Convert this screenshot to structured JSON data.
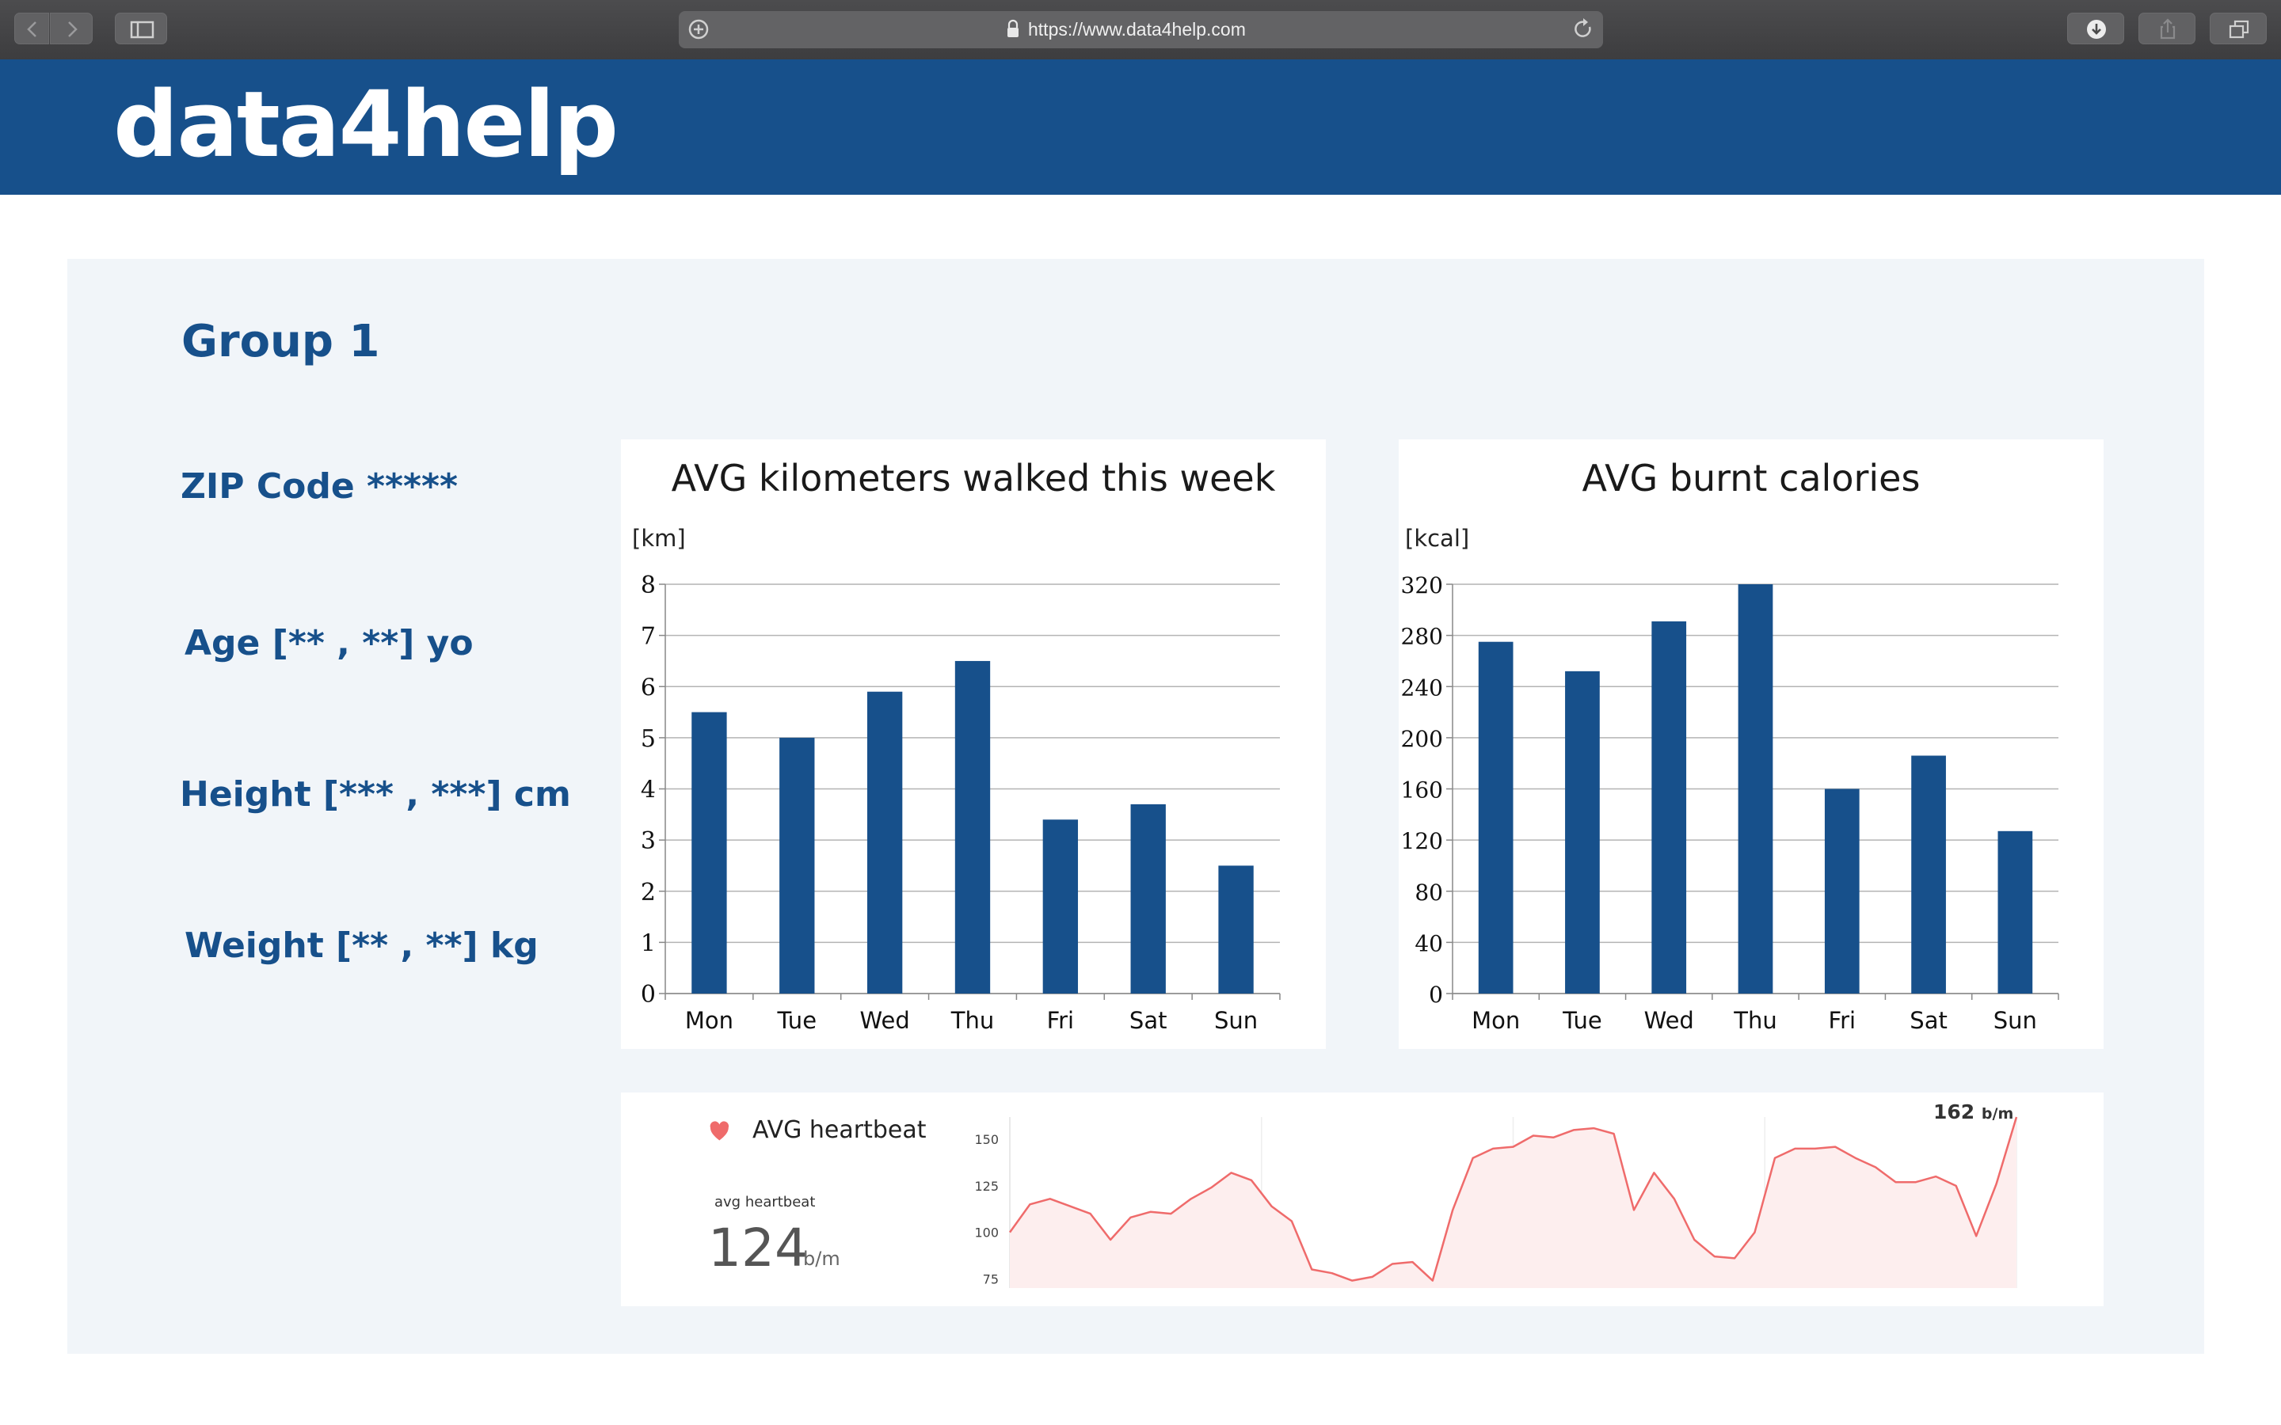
{
  "browser": {
    "url": "https://www.data4help.com"
  },
  "header": {
    "logo": "data4help"
  },
  "group": {
    "title": "Group 1",
    "info": [
      "ZIP Code *****",
      "Age [** , **] yo",
      "Height [*** , ***] cm",
      "Weight [** , **] kg"
    ]
  },
  "colors": {
    "brand": "#17508b",
    "panel_bg": "#f1f5f9",
    "heartbeat_line": "#ef6b6b",
    "heartbeat_fill": "#fdeeee"
  },
  "chart_data": [
    {
      "type": "bar",
      "title": "AVG kilometers walked this week",
      "ylabel": "[km]",
      "categories": [
        "Mon",
        "Tue",
        "Wed",
        "Thu",
        "Fri",
        "Sat",
        "Sun"
      ],
      "values": [
        5.5,
        5.0,
        5.9,
        6.5,
        3.4,
        3.7,
        2.5
      ],
      "ylim": [
        0,
        8
      ],
      "yticks": [
        0,
        1,
        2,
        3,
        4,
        5,
        6,
        7,
        8
      ],
      "grid": true,
      "color": "#17508b"
    },
    {
      "type": "bar",
      "title": "AVG burnt calories",
      "ylabel": "[kcal]",
      "categories": [
        "Mon",
        "Tue",
        "Wed",
        "Thu",
        "Fri",
        "Sat",
        "Sun"
      ],
      "values": [
        275,
        252,
        291,
        320,
        160,
        186,
        127
      ],
      "ylim": [
        0,
        320
      ],
      "yticks": [
        0,
        40,
        80,
        120,
        160,
        200,
        240,
        280,
        320
      ],
      "grid": true,
      "color": "#17508b"
    },
    {
      "type": "area",
      "title": "AVG heartbeat",
      "summary_label": "avg heartbeat",
      "summary_value": "124",
      "summary_unit": "b/m",
      "peak_value": "162",
      "peak_unit": "b/m",
      "ylim": [
        70,
        162
      ],
      "yticks": [
        75,
        100,
        125,
        150
      ],
      "x": [
        0,
        2,
        4,
        6,
        8,
        10,
        12,
        14,
        16,
        18,
        20,
        22,
        24,
        26,
        28,
        30,
        32,
        34,
        36,
        38,
        40,
        42,
        44,
        46,
        48,
        50,
        52,
        54,
        56,
        58,
        60,
        62,
        64,
        66,
        68,
        70,
        72,
        74,
        76,
        78,
        80,
        82,
        84,
        86,
        88,
        90,
        92,
        94,
        96,
        98,
        100
      ],
      "y": [
        100,
        115,
        118,
        114,
        110,
        96,
        108,
        111,
        110,
        118,
        124,
        132,
        128,
        114,
        106,
        80,
        78,
        74,
        76,
        83,
        84,
        74,
        112,
        140,
        145,
        146,
        152,
        151,
        155,
        156,
        153,
        112,
        132,
        118,
        96,
        87,
        86,
        100,
        140,
        145,
        145,
        146,
        140,
        135,
        127,
        127,
        130,
        125,
        98,
        126,
        162
      ]
    }
  ]
}
